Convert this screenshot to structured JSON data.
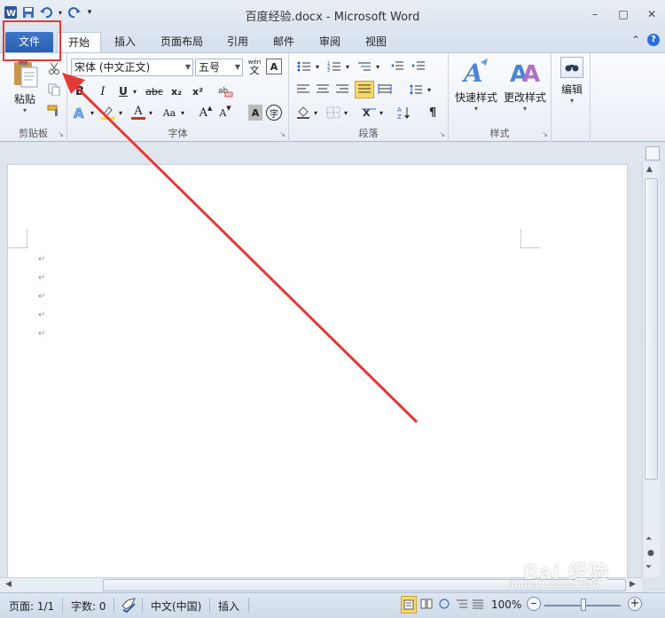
{
  "window": {
    "title": "百度经验.docx - Microsoft Word",
    "controls": {
      "minimize": "–",
      "maximize": "□",
      "close": "✕"
    }
  },
  "qat": {
    "customize_glyph": "▾"
  },
  "tabs": [
    {
      "label": "文件",
      "kind": "file"
    },
    {
      "label": "开始",
      "kind": "active"
    },
    {
      "label": "插入"
    },
    {
      "label": "页面布局"
    },
    {
      "label": "引用"
    },
    {
      "label": "邮件"
    },
    {
      "label": "审阅"
    },
    {
      "label": "视图"
    }
  ],
  "tabbar_right": {
    "minimize_ribbon": "⌃",
    "help": "?"
  },
  "ribbon": {
    "clipboard": {
      "label": "剪贴板",
      "paste": "粘贴"
    },
    "font": {
      "label": "字体",
      "font_name": "宋体 (中文正文)",
      "font_size": "五号",
      "wen": "wén",
      "wen_char": "文",
      "bold": "B",
      "italic": "I",
      "underline": "U",
      "strike": "abc",
      "sub": "x₂",
      "sup": "x²",
      "font_color": "A",
      "change_case": "Aa",
      "grow": "A",
      "shrink": "A",
      "char_shading": "A",
      "enclose": "字"
    },
    "paragraph": {
      "label": "段落"
    },
    "styles": {
      "label": "样式",
      "quick": "快速样式",
      "change": "更改样式"
    },
    "editing": {
      "label": "编辑"
    }
  },
  "document": {
    "paragraph_marks": [
      "↵",
      "↵",
      "↵",
      "↵",
      "↵"
    ]
  },
  "status": {
    "page": "页面: 1/1",
    "words": "字数: 0",
    "language": "中文(中国)",
    "mode": "插入",
    "zoom": "100%"
  },
  "watermark": {
    "logo": "Bai 经验",
    "url": "jingyan.baidu.com"
  },
  "colors": {
    "accent": "#2a5fb0",
    "annotation": "#e53935",
    "font_color_bar": "#d32f2f"
  }
}
